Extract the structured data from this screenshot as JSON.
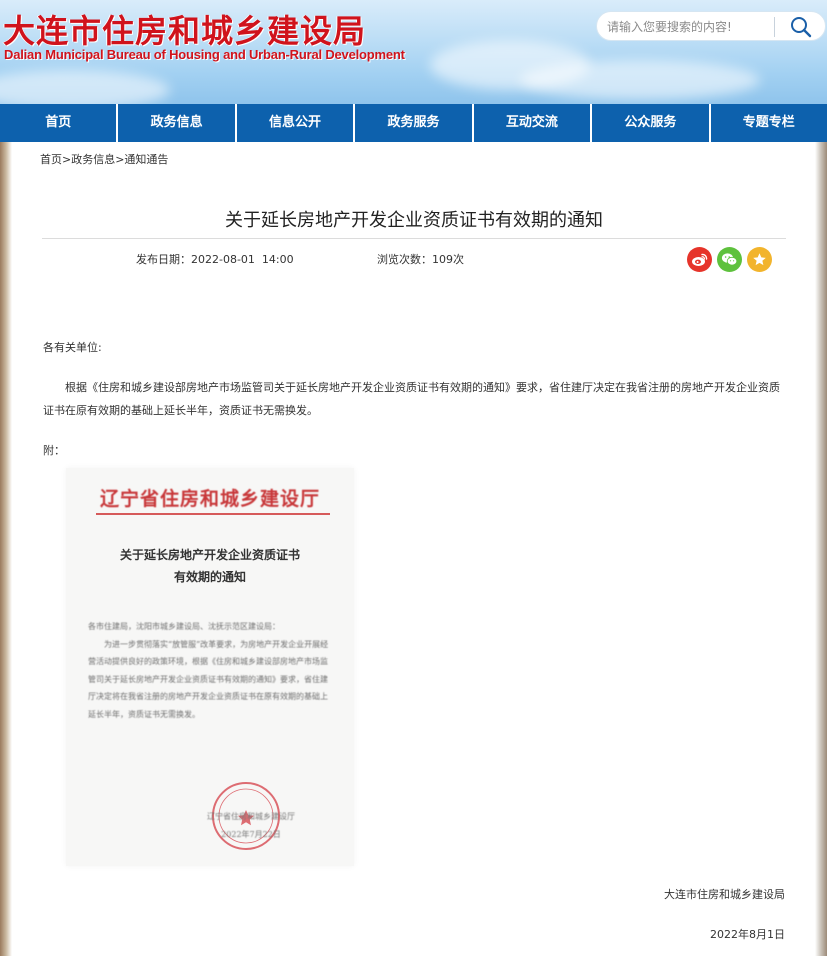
{
  "header": {
    "title": "大连市住房和城乡建设局",
    "subtitle": "Dalian Municipal Bureau of Housing and Urban-Rural Development",
    "search_placeholder": "请输入您要搜索的内容!"
  },
  "nav": {
    "items": [
      {
        "label": "首页"
      },
      {
        "label": "政务信息"
      },
      {
        "label": "信息公开"
      },
      {
        "label": "政务服务"
      },
      {
        "label": "互动交流"
      },
      {
        "label": "公众服务"
      },
      {
        "label": "专题专栏"
      }
    ]
  },
  "breadcrumb": "首页>政务信息>通知通告",
  "article": {
    "title": "关于延长房地产开发企业资质证书有效期的通知",
    "publish_label": "发布日期：",
    "publish_date": "2022-08-01  14:00",
    "views_label": "浏览次数：",
    "views": "109次",
    "salutation": "各有关单位:",
    "body": "根据《住房和城乡建设部房地产市场监管司关于延长房地产开发企业资质证书有效期的通知》要求，省住建厅决定在我省注册的房地产开发企业资质证书在原有效期的基础上延长半年，资质证书无需换发。",
    "attachment_label": "附：",
    "signature_org": "大连市住房和城乡建设局",
    "signature_date": "2022年8月1日"
  },
  "attachment_doc": {
    "heading": "辽宁省住房和城乡建设厅",
    "title_line1": "关于延长房地产开发企业资质证书",
    "title_line2": "有效期的通知",
    "addressee": "各市住建局，沈阳市城乡建设局、沈抚示范区建设局：",
    "paragraph": "为进一步贯彻落实“放管服”改革要求，为房地产开发企业开展经营活动提供良好的政策环境，根据《住房和城乡建设部房地产市场监管司关于延长房地产开发企业资质证书有效期的通知》要求，省住建厅决定将在我省注册的房地产开发企业资质证书在原有效期的基础上延长半年，资质证书无需换发。",
    "sign_org": "辽宁省住房和城乡建设厅",
    "sign_date": "2022年7月22日"
  },
  "colors": {
    "brand_red": "#d0131c",
    "nav_blue": "#0d61ad",
    "weibo": "#e6342a",
    "wechat": "#5ec13d",
    "favorite": "#f2b42c",
    "seal_red": "#d9545c"
  },
  "icons": [
    "search-icon",
    "weibo-icon",
    "wechat-icon",
    "star-icon",
    "seal-star-icon"
  ]
}
